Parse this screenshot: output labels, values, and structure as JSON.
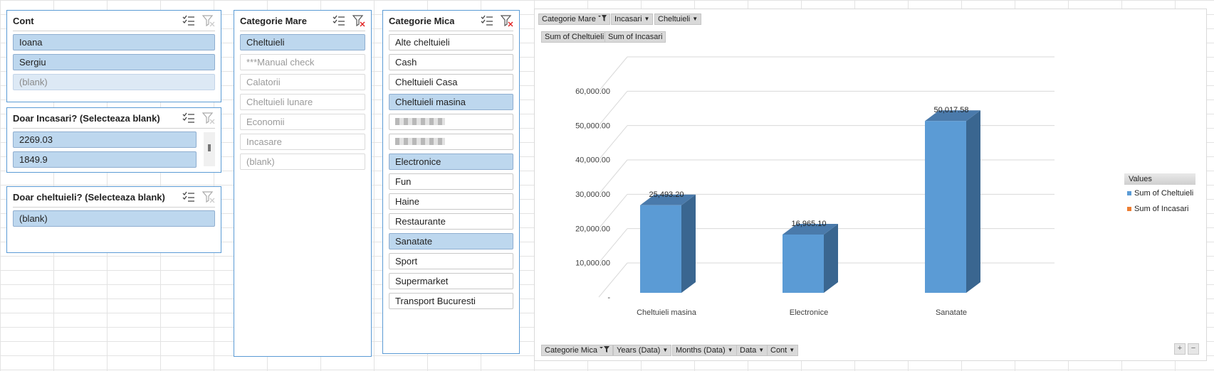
{
  "slicers": {
    "cont": {
      "title": "Cont",
      "items": [
        {
          "label": "Ioana"
        },
        {
          "label": "Sergiu"
        },
        {
          "label": "(blank)"
        }
      ]
    },
    "incasari": {
      "title": "Doar Incasari? (Selecteaza blank)",
      "items": [
        {
          "label": "2269.03"
        },
        {
          "label": "1849.9"
        }
      ]
    },
    "cheltuieli": {
      "title": "Doar cheltuieli? (Selecteaza blank)",
      "items": [
        {
          "label": "(blank)"
        }
      ]
    },
    "categorie_mare": {
      "title": "Categorie Mare",
      "items": [
        {
          "label": "Cheltuieli"
        },
        {
          "label": "***Manual check"
        },
        {
          "label": "Calatorii"
        },
        {
          "label": "Cheltuieli lunare"
        },
        {
          "label": "Economii"
        },
        {
          "label": "Incasare"
        },
        {
          "label": "(blank)"
        }
      ]
    },
    "categorie_mica": {
      "title": "Categorie Mica",
      "items": [
        {
          "label": "Alte cheltuieli"
        },
        {
          "label": "Cash"
        },
        {
          "label": "Cheltuieli Casa"
        },
        {
          "label": "Cheltuieli masina"
        },
        {
          "label": ""
        },
        {
          "label": ""
        },
        {
          "label": "Electronice"
        },
        {
          "label": "Fun"
        },
        {
          "label": "Haine"
        },
        {
          "label": "Restaurante"
        },
        {
          "label": "Sanatate"
        },
        {
          "label": "Sport"
        },
        {
          "label": "Supermarket"
        },
        {
          "label": "Transport Bucuresti"
        }
      ]
    }
  },
  "chart": {
    "filter_buttons": [
      {
        "label": "Categorie Mare"
      },
      {
        "label": "Incasari"
      },
      {
        "label": "Cheltuieli"
      }
    ],
    "value_buttons": [
      {
        "label": "Sum of Cheltuieli"
      },
      {
        "label": "Sum of Incasari"
      }
    ],
    "axis_buttons": [
      {
        "label": "Categorie Mica"
      },
      {
        "label": "Years (Data)"
      },
      {
        "label": "Months (Data)"
      },
      {
        "label": "Data"
      },
      {
        "label": "Cont"
      }
    ],
    "legend_title": "Values",
    "zoom_plus": "+",
    "zoom_minus": "−"
  },
  "chart_data": {
    "type": "bar",
    "categories": [
      "Cheltuieli masina",
      "Electronice",
      "Sanatate"
    ],
    "series": [
      {
        "name": "Sum of Cheltuieli",
        "values": [
          25493.2,
          16965.1,
          50017.58
        ],
        "color": "#5b9bd5"
      },
      {
        "name": "Sum of Incasari",
        "values": [
          null,
          null,
          null
        ],
        "color": "#ed7d31"
      }
    ],
    "data_labels": [
      "25,493.20",
      "16,965.10",
      "50,017.58"
    ],
    "ylim": [
      0,
      60000
    ],
    "y_ticks": [
      {
        "value": 0,
        "label": "-"
      },
      {
        "value": 10000,
        "label": "10,000.00"
      },
      {
        "value": 20000,
        "label": "20,000.00"
      },
      {
        "value": 30000,
        "label": "30,000.00"
      },
      {
        "value": 40000,
        "label": "40,000.00"
      },
      {
        "value": 50000,
        "label": "50,000.00"
      },
      {
        "value": 60000,
        "label": "60,000.00"
      }
    ],
    "grid": true,
    "legend_position": "right",
    "style": "3d-column"
  }
}
